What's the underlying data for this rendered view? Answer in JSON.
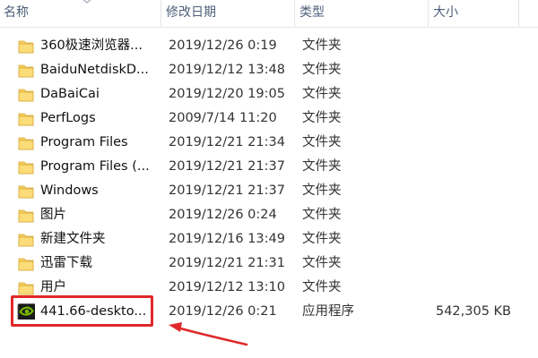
{
  "columns": {
    "name": "名称",
    "date": "修改日期",
    "type": "类型",
    "size": "大小"
  },
  "rows": [
    {
      "icon": "folder-icon",
      "name": "360极速浏览器...",
      "date": "2019/12/26 0:19",
      "type": "文件夹",
      "size": ""
    },
    {
      "icon": "folder-icon",
      "name": "BaiduNetdiskD...",
      "date": "2019/12/12 13:48",
      "type": "文件夹",
      "size": ""
    },
    {
      "icon": "folder-icon",
      "name": "DaBaiCai",
      "date": "2019/12/20 19:05",
      "type": "文件夹",
      "size": ""
    },
    {
      "icon": "folder-icon",
      "name": "PerfLogs",
      "date": "2009/7/14 11:20",
      "type": "文件夹",
      "size": ""
    },
    {
      "icon": "folder-icon",
      "name": "Program Files",
      "date": "2019/12/21 21:34",
      "type": "文件夹",
      "size": ""
    },
    {
      "icon": "folder-icon",
      "name": "Program Files (...",
      "date": "2019/12/21 21:37",
      "type": "文件夹",
      "size": ""
    },
    {
      "icon": "folder-icon",
      "name": "Windows",
      "date": "2019/12/21 21:37",
      "type": "文件夹",
      "size": ""
    },
    {
      "icon": "folder-icon",
      "name": "图片",
      "date": "2019/12/26 0:24",
      "type": "文件夹",
      "size": ""
    },
    {
      "icon": "folder-icon",
      "name": "新建文件夹",
      "date": "2019/12/16 13:49",
      "type": "文件夹",
      "size": ""
    },
    {
      "icon": "folder-icon",
      "name": "迅雷下载",
      "date": "2019/12/21 21:31",
      "type": "文件夹",
      "size": ""
    },
    {
      "icon": "folder-icon",
      "name": "用户",
      "date": "2019/12/12 13:10",
      "type": "文件夹",
      "size": ""
    },
    {
      "icon": "nvidia-app-icon",
      "name": "441.66-deskto...",
      "date": "2019/12/26 0:21",
      "type": "应用程序",
      "size": "542,305 KB"
    }
  ],
  "colors": {
    "header_text": "#4c607a",
    "highlight_box": "#e0282a",
    "arrow": "#e0282a",
    "folder_yellow": "#f6cf5b",
    "nvidia_green": "#76b900"
  }
}
